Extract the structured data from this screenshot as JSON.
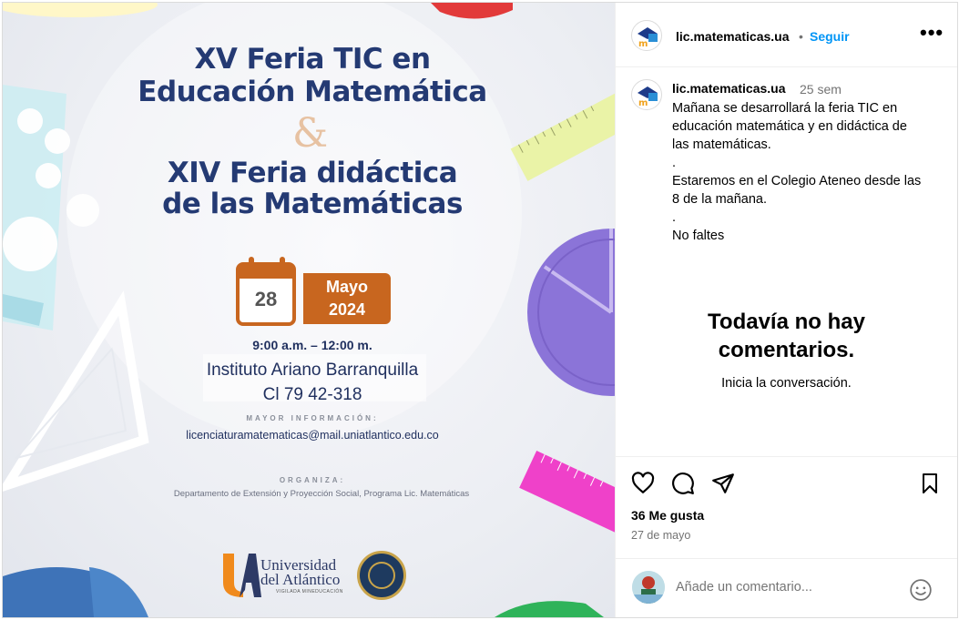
{
  "post": {
    "poster": {
      "title_line1": "XV Feria TIC en",
      "title_line2": "Educación Matemática",
      "ampersand": "&",
      "title_line3": "XIV Feria didáctica",
      "title_line4": "de las Matemáticas",
      "day": "28",
      "month": "Mayo",
      "year": "2024",
      "time": "9:00 a.m. – 12:00 m.",
      "venue_line1": "Instituto Ariano Barranquilla",
      "venue_line2": "Cl 79  42-318",
      "info_label": "MAYOR INFORMACIÓN:",
      "email": "licenciaturamatematicas@mail.uniatlantico.edu.co",
      "org_label": "ORGANIZA:",
      "org_text": "Departamento de Extensión y Proyección Social, Programa Lic. Matemáticas",
      "university_line1": "Universidad",
      "university_line2": "del Atlántico",
      "university_sub": "VIGILADA MINEDUCACIÓN"
    }
  },
  "sidebar": {
    "header": {
      "username": "lic.matematicas.ua",
      "dot": "•",
      "follow_label": "Seguir",
      "more_label": "•••"
    },
    "caption": {
      "username": "lic.matematicas.ua",
      "time_ago": "25 sem",
      "lines": [
        "Mañana se desarrollará la feria TIC en",
        "educación matemática y en didáctica de",
        "las matemáticas.",
        ".",
        "Estaremos en el Colegio Ateneo desde las",
        "8 de la mañana.",
        ".",
        "No faltes"
      ]
    },
    "empty_comments": {
      "title_line1": "Todavía no hay",
      "title_line2": "comentarios.",
      "subtitle": "Inicia la conversación."
    },
    "actions": {
      "icons": [
        "heart-icon",
        "comment-icon",
        "share-icon",
        "bookmark-icon"
      ],
      "likes": "36 Me gusta",
      "date": "27 de mayo"
    },
    "comment_input": {
      "placeholder": "Añade un comentario...",
      "emoji_icon": "smiley-icon"
    }
  },
  "colors": {
    "accent_blue": "#0095f6",
    "poster_navy": "#243a73",
    "poster_orange": "#c8661f"
  }
}
